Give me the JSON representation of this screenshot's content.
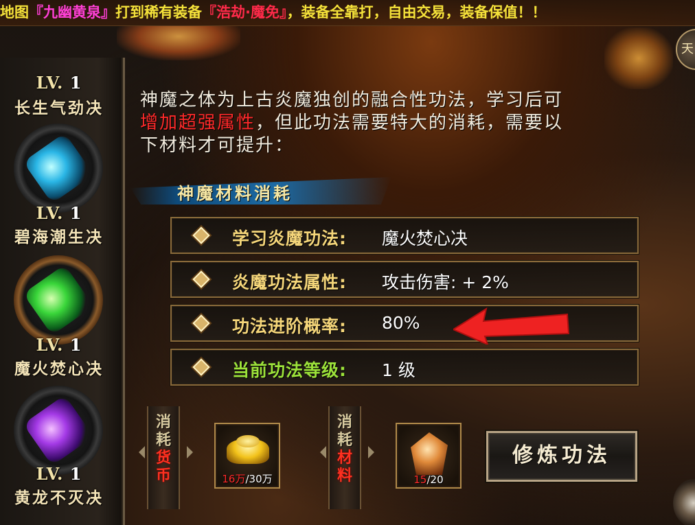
{
  "marquee": {
    "prefix": "地图",
    "map_name": "『九幽黄泉』",
    "middle": "打到稀有装备",
    "item_name": "『浩劫·魔免』",
    "suffix": "，装备全靠打，自由交易，装备保值！！"
  },
  "corner_badge": "天",
  "skills": [
    {
      "level_tag": "LV.",
      "level": "1",
      "name": "长生气劲决"
    },
    {
      "level_tag": "LV.",
      "level": "1",
      "name": "碧海潮生决",
      "gem": "cyan-scroll-icon"
    },
    {
      "level_tag": "LV.",
      "level": "1",
      "name": "魔火焚心决",
      "gem": "green-scroll-icon"
    },
    {
      "level_tag": "LV.",
      "level": "1",
      "name": "黄龙不灭决",
      "gem": "purple-scroll-icon"
    }
  ],
  "description": {
    "line1": "神魔之体为上古炎魔独创的融合性功法，学习后可",
    "highlight": "增加超强属性",
    "line2_rest": "，但此功法需要特大的消耗，需要以",
    "line3": "下材料才可提升："
  },
  "section_title": "神魔材料消耗",
  "info_rows": [
    {
      "label": "学习炎魔功法:",
      "value": "魔火焚心决"
    },
    {
      "label": "炎魔功法属性:",
      "value": "攻击伤害: + 2%"
    },
    {
      "label": "功法进阶概率:",
      "value": "80%"
    },
    {
      "label": "当前功法等级:",
      "value": "1 级"
    }
  ],
  "consume_currency": {
    "label_chars": [
      "消",
      "耗",
      "货",
      "币"
    ],
    "current": "16万",
    "total": "/30万",
    "icon": "gold-ingot-icon"
  },
  "consume_material": {
    "label_chars": [
      "消",
      "耗",
      "材",
      "料"
    ],
    "current": "15",
    "total": "/20",
    "icon": "crystal-ore-icon"
  },
  "train_button": "修炼功法",
  "colors": {
    "highlight_red": "#ff2a2a",
    "label_gold": "#f5d67a",
    "label_green": "#9ce23a",
    "marquee_yellow": "#f5e23a",
    "arrow_red": "#ee2222"
  }
}
